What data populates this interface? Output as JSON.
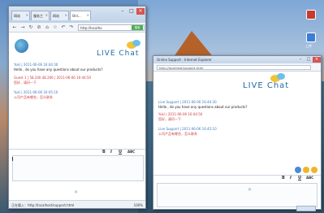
{
  "browser": {
    "tabs": [
      {
        "label": "网站"
      },
      {
        "label": "服务工"
      },
      {
        "label": "网站"
      },
      {
        "label": "Onl..."
      }
    ],
    "address": "http://localho",
    "go_label": "搜索",
    "status_text": "正在载入：http://localhost/support.html",
    "zoom": "100%"
  },
  "chat_left": {
    "logo_text": "LIVE Chat",
    "messages": [
      {
        "who": "Yuki | 2011-06-06 16:44:30",
        "text": "Hello , do you have any questions about our products?",
        "role": "agent"
      },
      {
        "who": "Guest 1 | 58.240.48.206 | 2011-06-06 16:44:50",
        "text": "您好，请问一下",
        "role": "cust"
      },
      {
        "who": "Yuki | 2011-06-06 16:45:10",
        "text": "公司产品有哪些，怎么联系",
        "role": "agent"
      }
    ],
    "format_buttons": [
      "B",
      "I",
      "U",
      "ABC"
    ]
  },
  "support_window": {
    "title": "Online Support - Internet Explorer",
    "url": "http://localhost/support.html",
    "logo_text": "LIVE Chat",
    "messages": [
      {
        "who": "Live Support | 2011-06-06 16:44:30",
        "text": "Hello , do you have any questions about our products?",
        "role": "agent"
      },
      {
        "who": "Yuki | 2011-06-06 16:44:50",
        "text": "您好，请问一下",
        "role": "cust"
      },
      {
        "who": "Live Support | 2011-06-06 16:45:10",
        "text": "公司产品有哪些，怎么联系",
        "role": "agent"
      }
    ],
    "format_buttons": [
      "B",
      "I",
      "U",
      "ABC"
    ]
  },
  "desktop": {
    "icon_label": "上传"
  }
}
